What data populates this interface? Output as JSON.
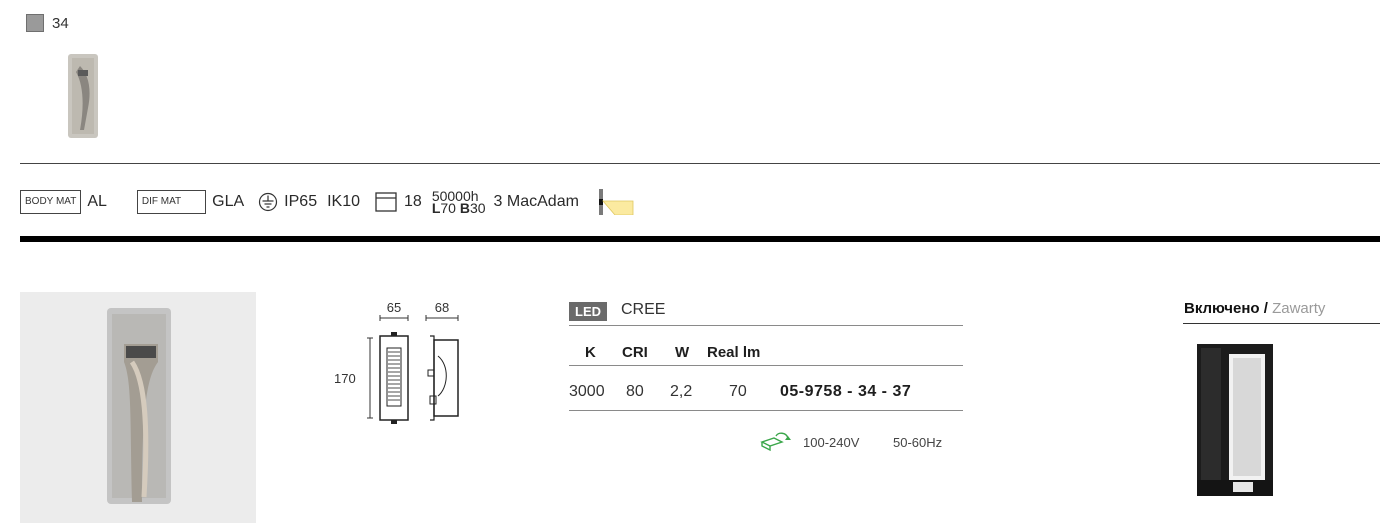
{
  "finish": {
    "swatch_color": "#9a9a9a",
    "code": "34"
  },
  "specs": {
    "body_mat_label": "BODY MAT",
    "body_mat_value": "AL",
    "dif_mat_label": "DIF MAT",
    "dif_mat_value": "GLA",
    "ip_rating": "IP65",
    "ik_rating": "IK10",
    "cutout_value": "18",
    "lifetime_hours": "50000h",
    "lifetime_l": "L",
    "lifetime_l_value": "70",
    "lifetime_b": "B",
    "lifetime_b_value": "30",
    "macadam": "3 MacAdam",
    "icons": [
      "ground-symbol-icon",
      "recessed-box-icon",
      "light-distribution-icon"
    ]
  },
  "drawing": {
    "width1": "65",
    "width2": "68",
    "height": "170"
  },
  "table": {
    "led_tag": "LED",
    "led_brand": "CREE",
    "headers": [
      "K",
      "CRI",
      "W",
      "Real lm"
    ],
    "row": [
      "3000",
      "80",
      "2,2",
      "70"
    ],
    "code": "05-9758 - 34 -  37",
    "voltage": "100-240V",
    "frequency": "50-60Hz"
  },
  "included": {
    "label": "Включено",
    "separator": "/",
    "label_alt": "Zawarty"
  }
}
